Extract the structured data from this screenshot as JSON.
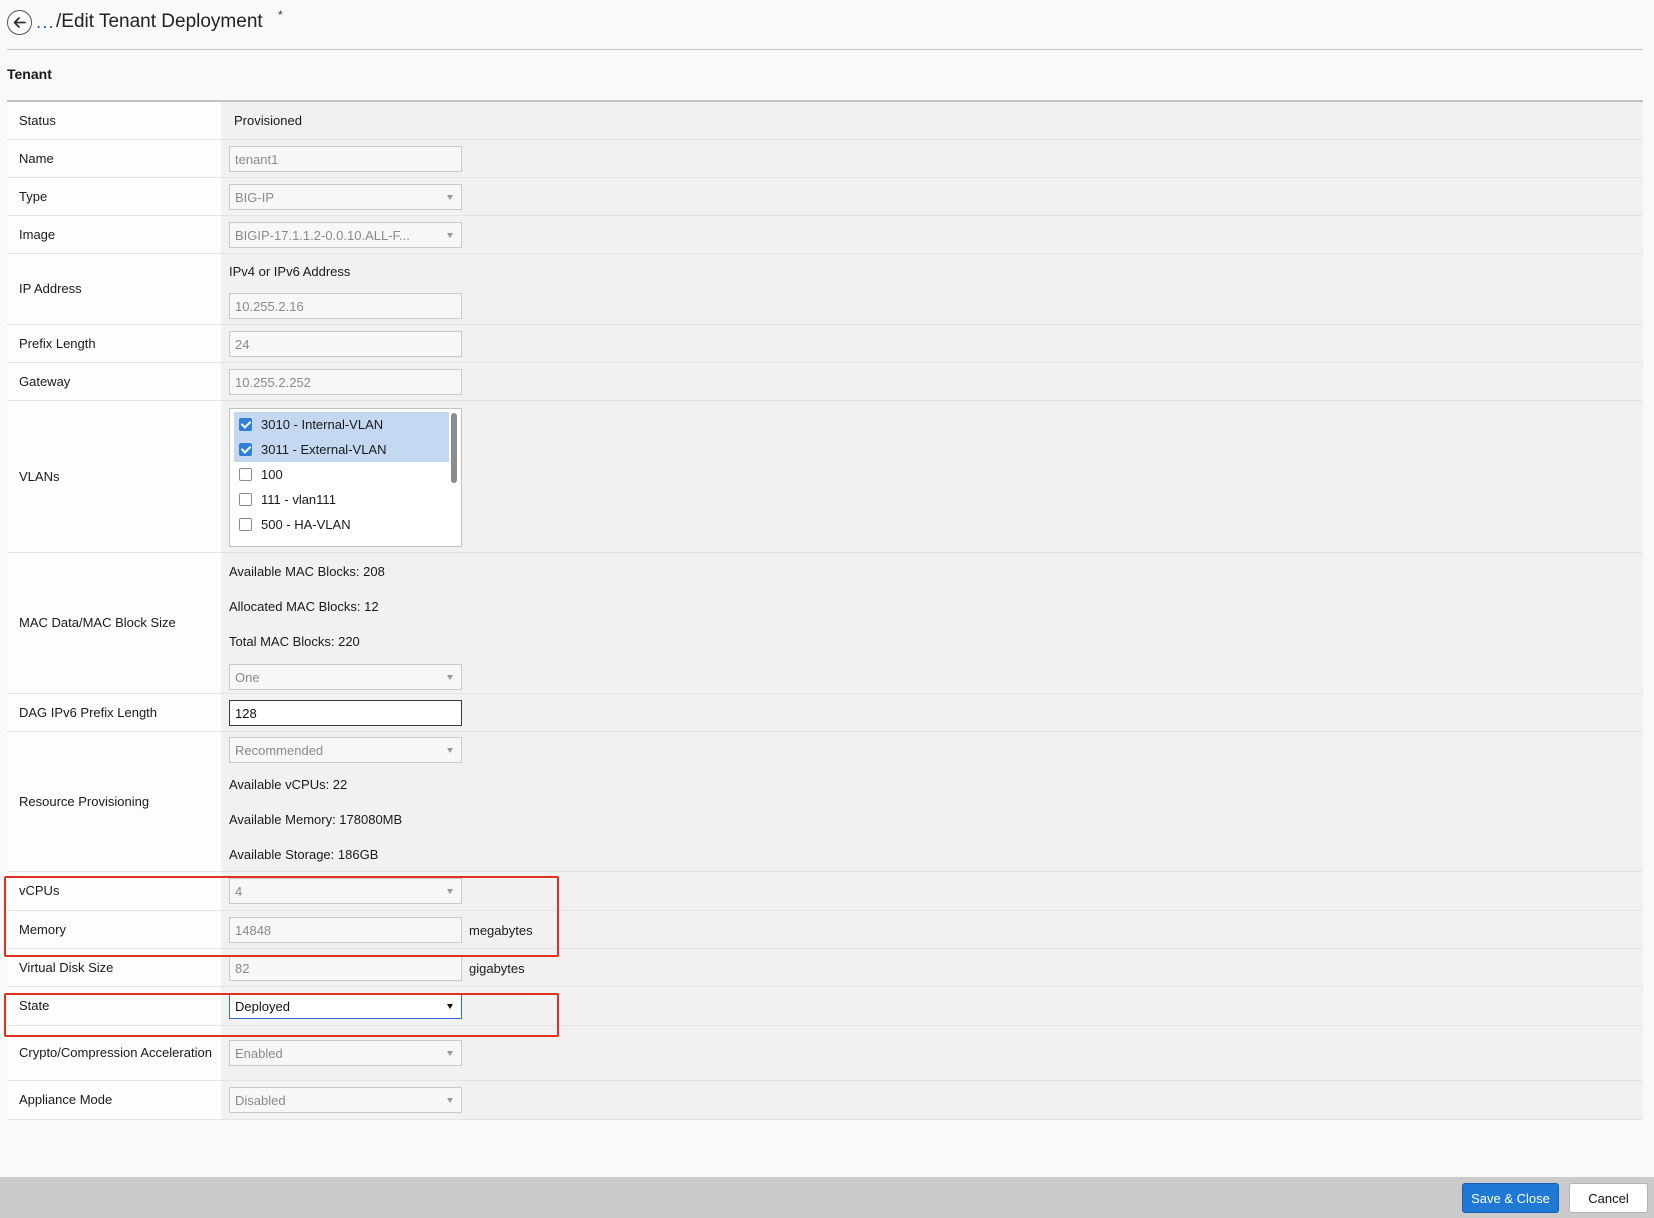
{
  "header": {
    "breadcrumb_ellipsis": "...",
    "title": "/Edit Tenant Deployment",
    "dirty_marker": "*"
  },
  "section": {
    "title": "Tenant"
  },
  "fields": {
    "status": {
      "label": "Status",
      "value": "Provisioned"
    },
    "name": {
      "label": "Name",
      "value": "tenant1"
    },
    "type": {
      "label": "Type",
      "value": "BIG-IP"
    },
    "image": {
      "label": "Image",
      "value": "BIGIP-17.1.1.2-0.0.10.ALL-F..."
    },
    "ip_address": {
      "label": "IP Address",
      "hint": "IPv4 or IPv6 Address",
      "value": "10.255.2.16"
    },
    "prefix_length": {
      "label": "Prefix Length",
      "value": "24"
    },
    "gateway": {
      "label": "Gateway",
      "value": "10.255.2.252"
    },
    "vlans": {
      "label": "VLANs",
      "items": [
        {
          "label": "3010 - Internal-VLAN",
          "checked": true
        },
        {
          "label": "3011 - External-VLAN",
          "checked": true
        },
        {
          "label": "100",
          "checked": false
        },
        {
          "label": "111 - vlan111",
          "checked": false
        },
        {
          "label": "500 - HA-VLAN",
          "checked": false
        }
      ]
    },
    "mac": {
      "label": "MAC Data/MAC Block Size",
      "available": "Available MAC Blocks: 208",
      "allocated": "Allocated MAC Blocks: 12",
      "total": "Total MAC Blocks: 220",
      "block_size": "One"
    },
    "dag": {
      "label": "DAG IPv6 Prefix Length",
      "value": "128"
    },
    "resource": {
      "label": "Resource Provisioning",
      "mode": "Recommended",
      "available_vcpus": "Available vCPUs: 22",
      "available_memory": "Available Memory: 178080MB",
      "available_storage": "Available Storage: 186GB"
    },
    "vcpus": {
      "label": "vCPUs",
      "value": "4"
    },
    "memory": {
      "label": "Memory",
      "value": "14848",
      "unit": "megabytes"
    },
    "disk": {
      "label": "Virtual Disk Size",
      "value": "82",
      "unit": "gigabytes"
    },
    "state": {
      "label": "State",
      "value": "Deployed"
    },
    "crypto": {
      "label": "Crypto/Compression Acceleration",
      "value": "Enabled"
    },
    "appliance": {
      "label": "Appliance Mode",
      "value": "Disabled"
    }
  },
  "footer": {
    "save_label": "Save & Close",
    "cancel_label": "Cancel"
  },
  "colors": {
    "accent": "#1f79d4",
    "highlight": "#e0301e",
    "selected_row": "#c4d8f2"
  }
}
